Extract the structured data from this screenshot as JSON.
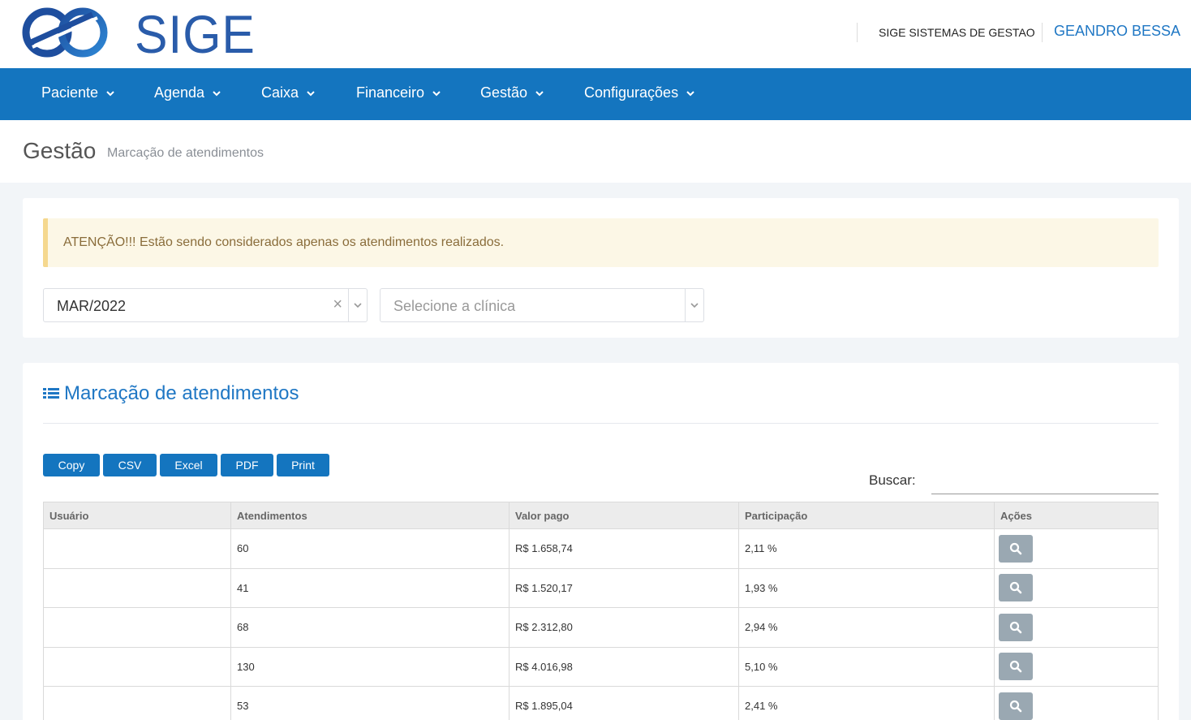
{
  "header": {
    "logo_text": "SIGE",
    "company": "SIGE SISTEMAS DE GESTAO",
    "user": "GEANDRO BESSA"
  },
  "nav": {
    "items": [
      {
        "label": "Paciente"
      },
      {
        "label": "Agenda"
      },
      {
        "label": "Caixa"
      },
      {
        "label": "Financeiro"
      },
      {
        "label": "Gestão"
      },
      {
        "label": "Configurações"
      }
    ]
  },
  "page": {
    "title": "Gestão",
    "subtitle": "Marcação de atendimentos"
  },
  "filters": {
    "alert": "ATENÇÃO!!! Estão sendo considerados apenas os atendimentos realizados.",
    "month_value": "MAR/2022",
    "clear_symbol": "×",
    "clinic_placeholder": "Selecione a clínica"
  },
  "report": {
    "title": "Marcação de atendimentos",
    "buttons": [
      "Copy",
      "CSV",
      "Excel",
      "PDF",
      "Print"
    ],
    "search_label": "Buscar:",
    "columns": [
      "Usuário",
      "Atendimentos",
      "Valor pago",
      "Participação",
      "Ações"
    ],
    "rows": [
      {
        "usuario": "",
        "atendimentos": "60",
        "valor": "R$ 1.658,74",
        "participacao": "2,11 %"
      },
      {
        "usuario": "",
        "atendimentos": "41",
        "valor": "R$ 1.520,17",
        "participacao": "1,93 %"
      },
      {
        "usuario": "",
        "atendimentos": "68",
        "valor": "R$ 2.312,80",
        "participacao": "2,94 %"
      },
      {
        "usuario": "",
        "atendimentos": "130",
        "valor": "R$ 4.016,98",
        "participacao": "5,10 %"
      },
      {
        "usuario": "",
        "atendimentos": "53",
        "valor": "R$ 1.895,04",
        "participacao": "2,41 %"
      }
    ]
  },
  "colors": {
    "primary": "#1475bf",
    "logo_blue": "#2a5caa",
    "alert_bg": "#fcf7e6",
    "alert_text": "#8a6d3b",
    "action_button": "#9aa8b2"
  }
}
